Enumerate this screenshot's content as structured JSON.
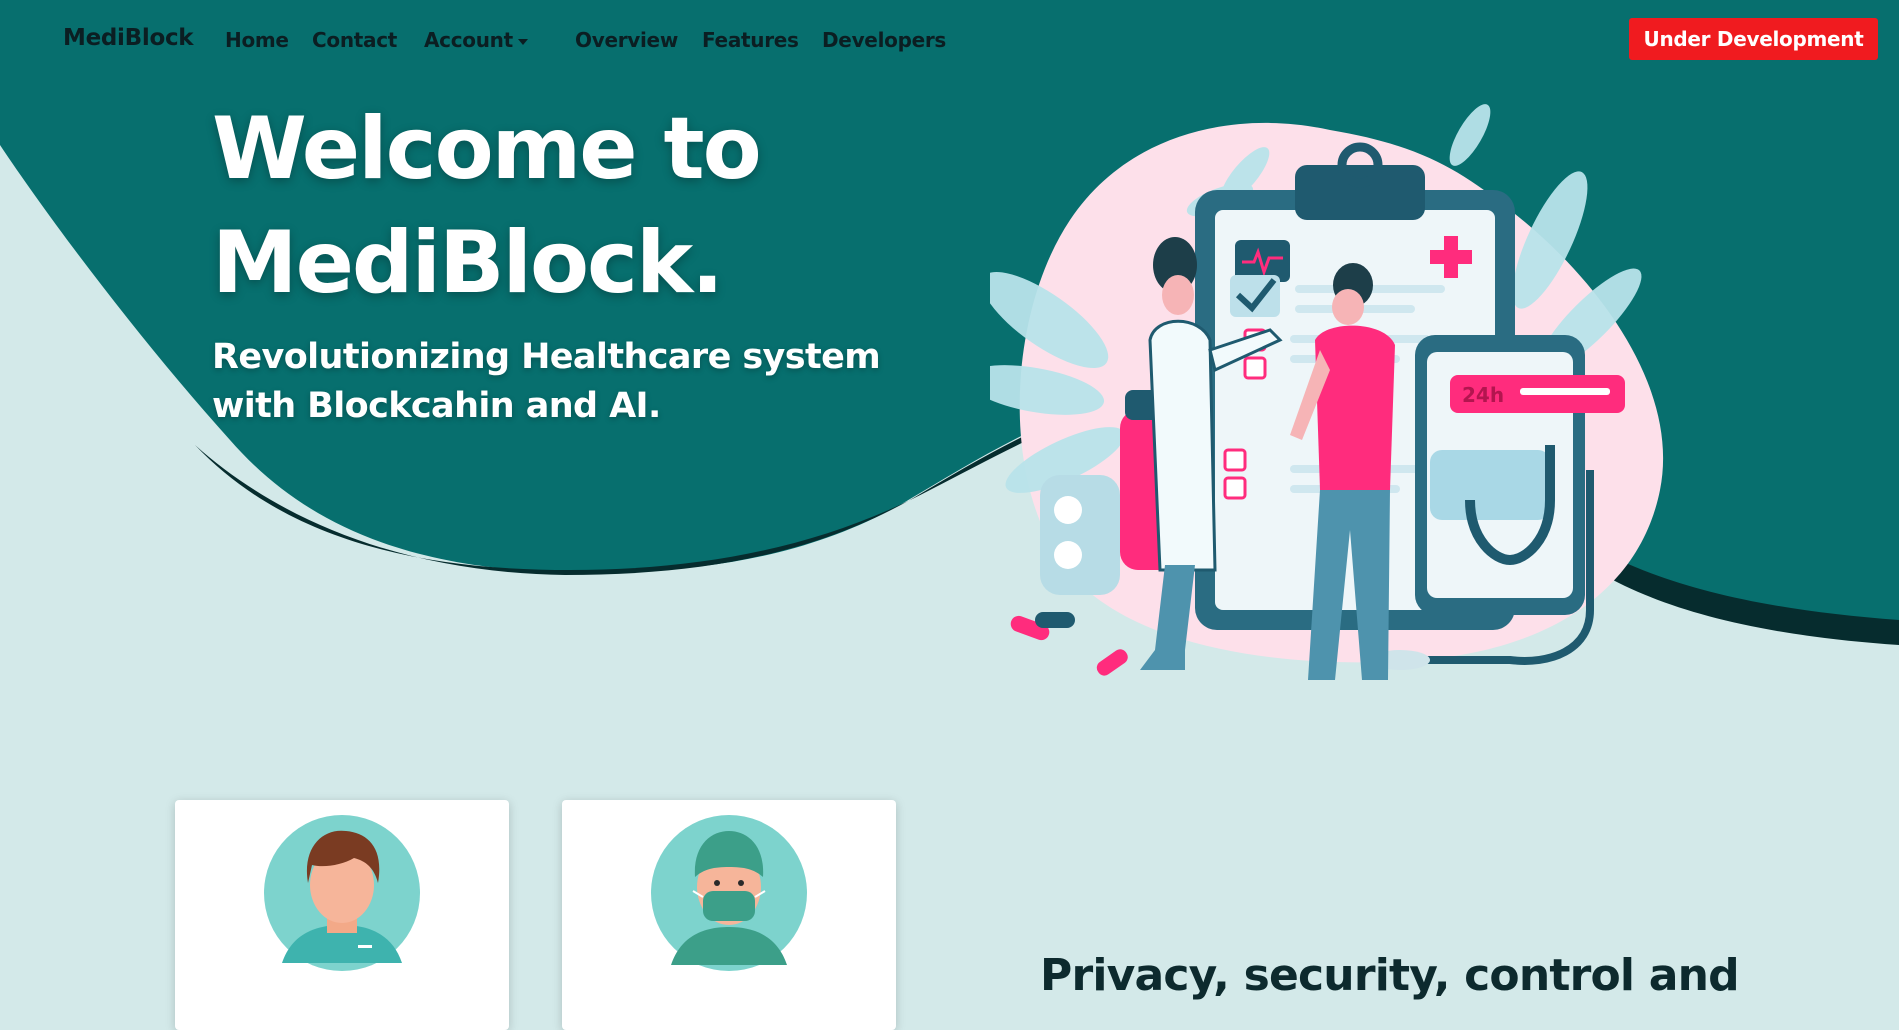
{
  "nav": {
    "brand": "MediBlock",
    "links": [
      "Home",
      "Contact",
      "Account",
      "Overview",
      "Features",
      "Developers"
    ],
    "badge": "Under Development"
  },
  "hero": {
    "title": "Welcome to MediBlock.",
    "subtitle": "Revolutionizing Healthcare system with Blockcahin and AI."
  },
  "illustration": {
    "badge_text": "24h"
  },
  "section": {
    "heading": "Privacy, security, control and"
  },
  "colors": {
    "teal_dark": "#036d6d",
    "teal_light": "#d3e9e9",
    "accent_red": "#f01b1f",
    "accent_pink": "#ff2c7d"
  },
  "icons": [
    "patient-avatar-icon",
    "doctor-avatar-icon",
    "heartbeat-icon",
    "medical-cross-icon",
    "checkmark-icon",
    "stethoscope-icon",
    "pill-icon"
  ]
}
